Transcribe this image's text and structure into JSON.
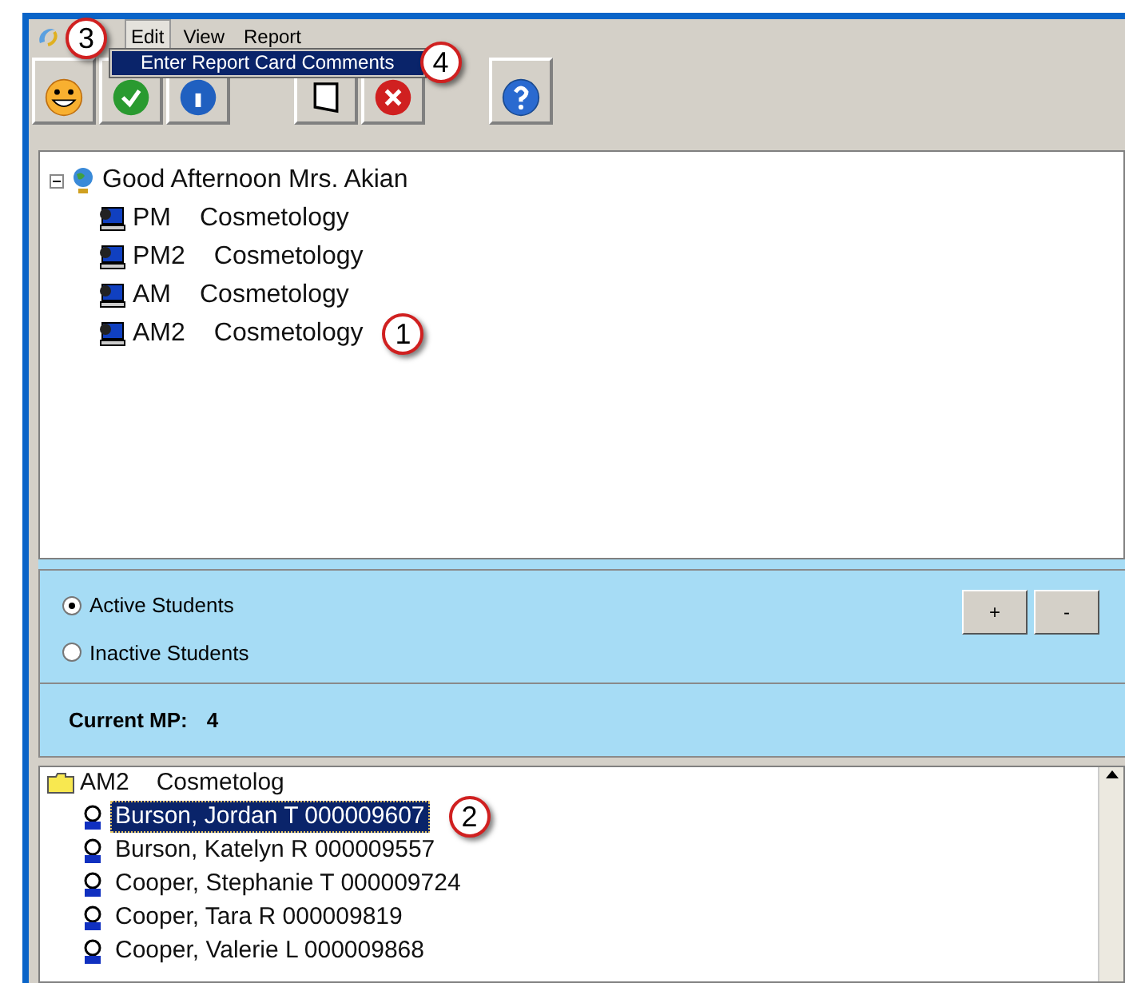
{
  "menu": {
    "callout": "3",
    "items": [
      {
        "label": "Edit",
        "selected": true
      },
      {
        "label": "View",
        "selected": false
      },
      {
        "label": "Report",
        "selected": false
      }
    ]
  },
  "dropdown": {
    "items": [
      {
        "label": "Enter Report Card Comments",
        "selected": true,
        "callout": "4"
      }
    ]
  },
  "class_tree": {
    "label": "Good Afternoon Mrs. Akian",
    "expanded": true,
    "children": [
      {
        "code": "PM",
        "subject": "Cosmetology"
      },
      {
        "code": "PM2",
        "subject": "Cosmetology"
      },
      {
        "code": "AM",
        "subject": "Cosmetology"
      },
      {
        "code": "AM2",
        "subject": "Cosmetology",
        "callout": "1"
      }
    ]
  },
  "filter": {
    "radios": [
      {
        "label": "Active Students",
        "selected": true
      },
      {
        "label": "Inactive Students",
        "selected": false
      }
    ],
    "buttons": [
      "+",
      "-"
    ]
  },
  "current_mp": {
    "label": "Current MP:",
    "value": "4"
  },
  "student_tree": {
    "code": "AM2",
    "subject": "Cosmetolog",
    "students": [
      {
        "label": "Burson, Jordan T 000009607",
        "selected": true,
        "callout": "2"
      },
      {
        "label": "Burson, Katelyn R 000009557",
        "selected": false
      },
      {
        "label": "Cooper, Stephanie T 000009724",
        "selected": false
      },
      {
        "label": "Cooper, Tara R 000009819",
        "selected": false
      },
      {
        "label": "Cooper, Valerie L 000009868",
        "selected": false
      }
    ]
  }
}
